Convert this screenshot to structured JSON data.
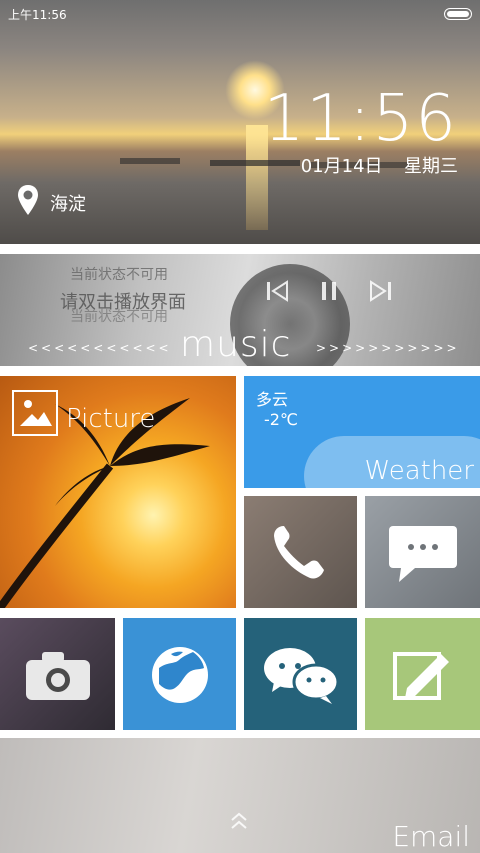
{
  "status": {
    "time": "上午11:56",
    "battery_icon": "battery-icon"
  },
  "hero": {
    "clock": "11:56",
    "date": "01月14日",
    "weekday": "星期三",
    "location": "海淀",
    "location_icon": "location-pin-icon"
  },
  "music": {
    "tips": [
      "当前状态不可用",
      "请双击播放界面",
      "当前状态不可用"
    ],
    "label": "music",
    "arrows_left": "<<<<<<<<<<<",
    "arrows_right": ">>>>>>>>>>>",
    "controls": [
      "previous-icon",
      "pause-icon",
      "next-icon"
    ]
  },
  "picture": {
    "label": "Picture",
    "icon": "picture-icon"
  },
  "weather": {
    "condition": "多云",
    "temperature": "-2℃",
    "label": "Weather"
  },
  "tiles": {
    "phone_icon": "phone-icon",
    "message_icon": "message-icon",
    "camera_icon": "camera-icon",
    "browser_icon": "globe-icon",
    "wechat_icon": "wechat-icon",
    "notes_icon": "edit-icon"
  },
  "email": {
    "label": "Email",
    "up_icon": "up-chevrons-icon"
  }
}
